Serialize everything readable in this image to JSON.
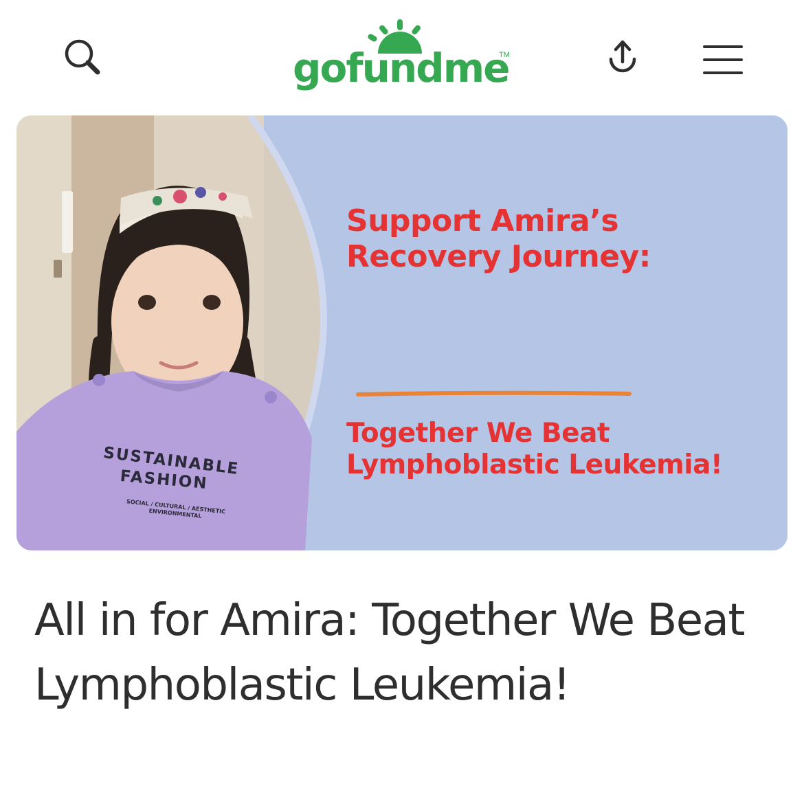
{
  "header": {
    "logo_text": "gofundme",
    "logo_tm": "TM",
    "icons": {
      "search": "search-icon",
      "share": "share-icon",
      "menu": "hamburger-menu-icon"
    }
  },
  "hero": {
    "headline": "Support Amira’s Recovery Journey:",
    "subheadline": "Together We Beat Lymphoblastic Leukemia!",
    "shirt_line1": "SUSTAINABLE",
    "shirt_line2": "FASHION",
    "shirt_small": "SOCIAL / CULTURAL / AESTHETIC ENVIRONMENTAL",
    "colors": {
      "panel": "#b4c5e6",
      "headline": "#e53333",
      "divider": "#e8843a"
    }
  },
  "campaign": {
    "title": "All in for Amira: Together We Beat Lymphoblastic Leukemia!"
  },
  "colors": {
    "brand": "#36a852",
    "icon": "#2e2e2e",
    "title": "#2e2e2e"
  }
}
